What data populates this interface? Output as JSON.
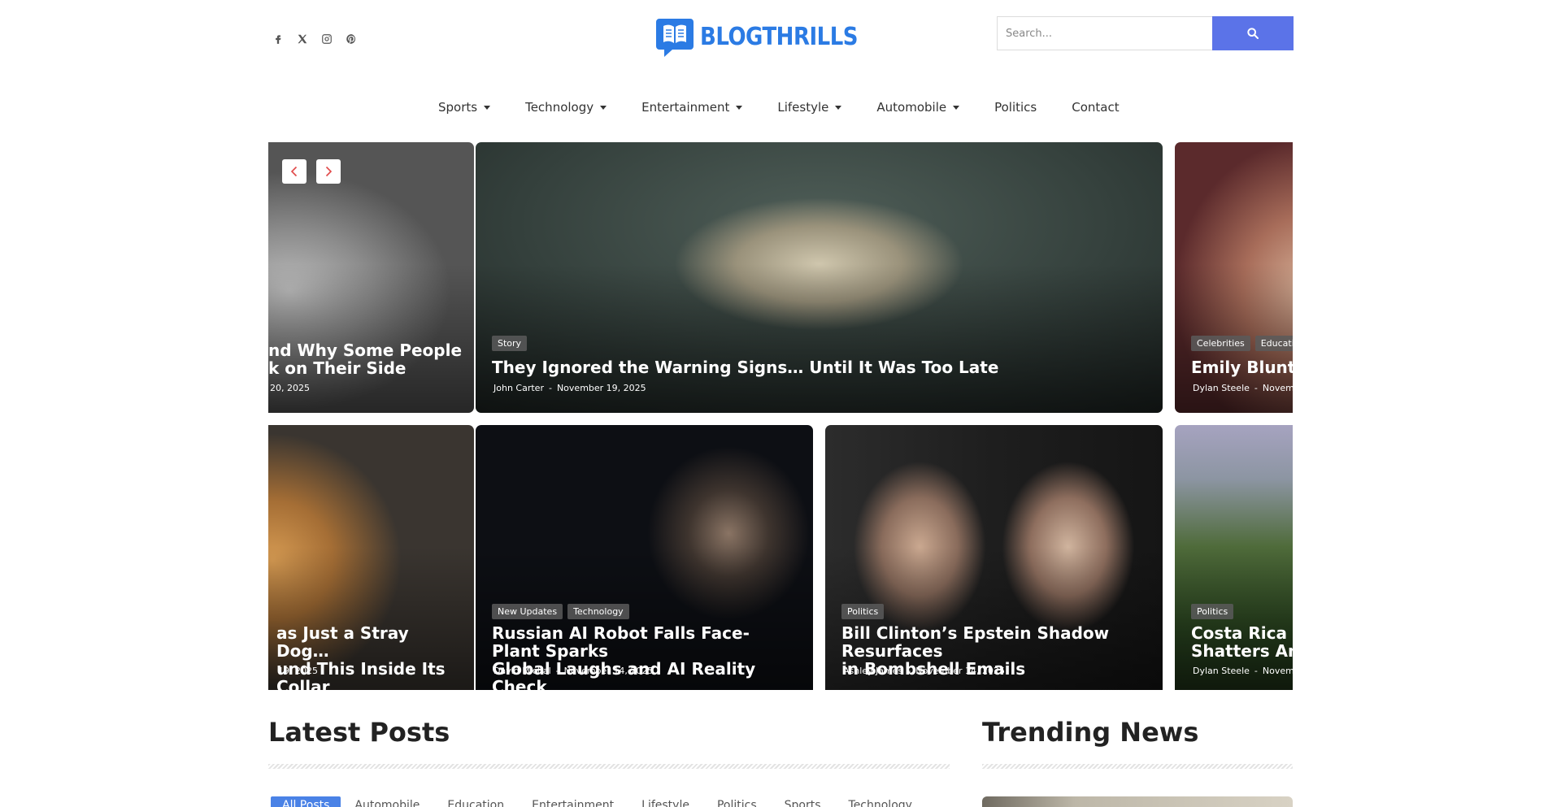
{
  "social": {
    "icons": [
      "facebook-icon",
      "x-icon",
      "instagram-icon",
      "pinterest-icon"
    ]
  },
  "logo": {
    "text": "BLOGTHRILLS",
    "color": "#2b7be4"
  },
  "search": {
    "placeholder": "Search..."
  },
  "nav": {
    "items": [
      {
        "label": "Sports",
        "dropdown": true
      },
      {
        "label": "Technology",
        "dropdown": true
      },
      {
        "label": "Entertainment",
        "dropdown": true
      },
      {
        "label": "Lifestyle",
        "dropdown": true
      },
      {
        "label": "Automobile",
        "dropdown": true
      },
      {
        "label": "Politics",
        "dropdown": false
      },
      {
        "label": "Contact",
        "dropdown": false
      }
    ]
  },
  "slider": {
    "row1": [
      {
        "tags": [],
        "title_line1": "nd Why Some People",
        "title_line2": "k on Their Side",
        "author": "",
        "date": "20, 2025"
      },
      {
        "tags": [
          "Story"
        ],
        "title_line1": "They Ignored the Warning Signs… Until It Was Too Late",
        "title_line2": "",
        "author": "John Carter",
        "date": "November 19, 2025"
      },
      {
        "tags": [
          "Celebrities",
          "Education"
        ],
        "title_line1": "Emily Blunt Cap",
        "title_line2": "",
        "author": "Dylan Steele",
        "date": "Novembe"
      }
    ],
    "row2": [
      {
        "tags": [],
        "title_line1": "as Just a Stray Dog…",
        "title_line2": "und This Inside Its Collar",
        "author": "",
        "date": "19, 2025"
      },
      {
        "tags": [
          "New Updates",
          "Technology"
        ],
        "title_line1": "Russian AI Robot Falls Face-Plant Sparks",
        "title_line2": "Global Laughs and AI Reality Check",
        "author": "David Michal",
        "date": "November 14, 2025"
      },
      {
        "tags": [
          "Politics"
        ],
        "title_line1": "Bill Clinton’s Epstein Shadow Resurfaces",
        "title_line2": "in Bombshell Emails",
        "author": "Ashley James",
        "date": "November 14, 2025"
      },
      {
        "tags": [
          "Politics"
        ],
        "title_line1": "Costa Rica and",
        "title_line2": "Shatters Amid C",
        "author": "Dylan Steele",
        "date": "Novembe"
      }
    ]
  },
  "latest": {
    "title": "Latest Posts",
    "filters": [
      "All Posts",
      "Automobile",
      "Education",
      "Entertainment",
      "Lifestyle",
      "Politics",
      "Sports",
      "Technology"
    ]
  },
  "trending": {
    "title": "Trending News"
  },
  "colors": {
    "accent": "#5b73e8",
    "filter_active": "#4a82e6",
    "arrow": "#e04848"
  }
}
